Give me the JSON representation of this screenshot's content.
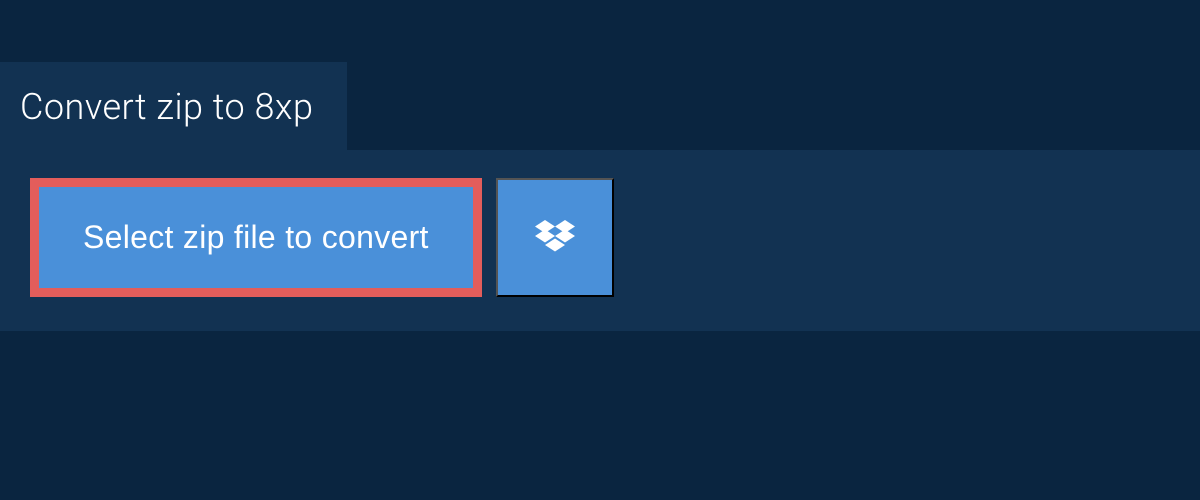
{
  "header": {
    "title": "Convert zip to 8xp"
  },
  "actions": {
    "select_file_label": "Select zip file to convert"
  },
  "colors": {
    "background": "#0a2540",
    "panel": "#123252",
    "button_primary": "#4a90d9",
    "button_highlight_border": "#e35d5b"
  }
}
